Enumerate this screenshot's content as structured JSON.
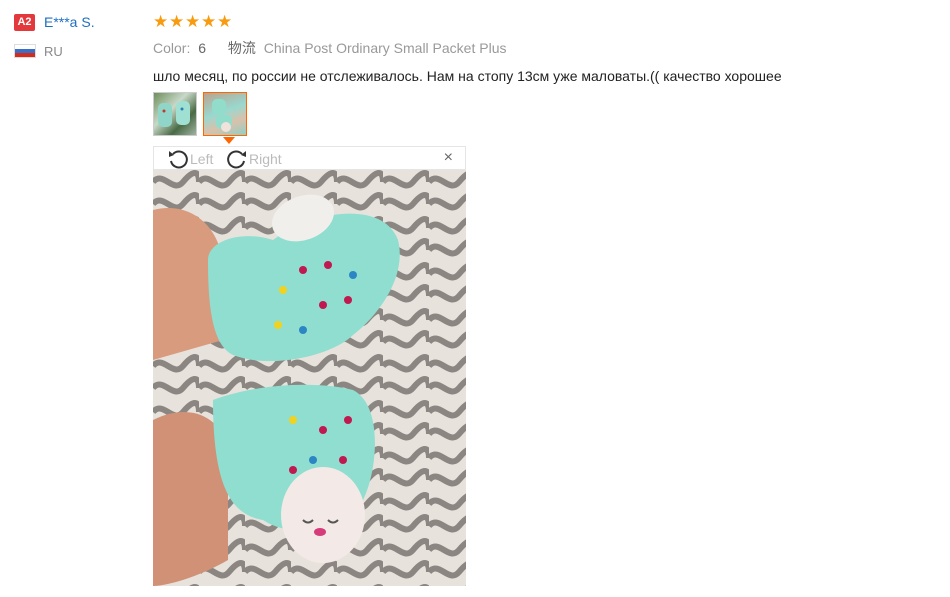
{
  "reviewer": {
    "level_badge": "A2",
    "name": "E***a S.",
    "country": "RU"
  },
  "review": {
    "rating": 5,
    "color_label": "Color:",
    "color_value": "6",
    "shipping_label": "物流",
    "shipping_value": "China Post Ordinary Small Packet Plus",
    "text": "шло месяц, по россии не отслеживалось. Нам на стопу 13см уже маловаты.(( качество хорошее"
  },
  "viewer": {
    "rotate_left_label": "Left",
    "rotate_right_label": "Right",
    "close_label": "×",
    "selected_thumbnail": 2
  },
  "colors": {
    "star": "#f99b10",
    "badge": "#e4393c",
    "username": "#1f6fc1",
    "active_border": "#ff6600"
  }
}
